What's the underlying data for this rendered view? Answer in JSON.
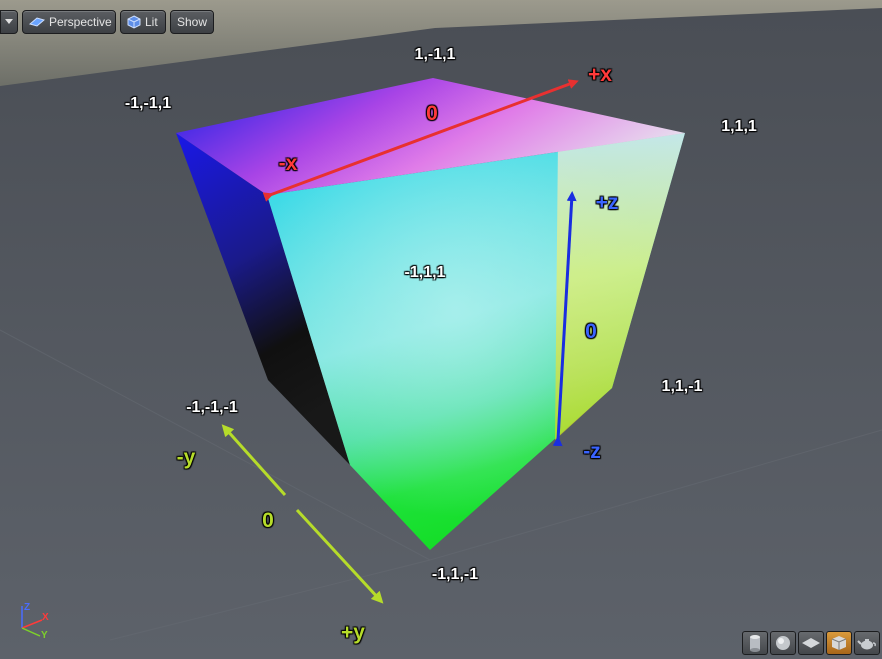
{
  "toolbar": {
    "menu_icon": "chevron-down-icon",
    "perspective_label": "Perspective",
    "lit_label": "Lit",
    "show_label": "Show"
  },
  "scene": {
    "vertex_labels": {
      "top_back": "1,-1,1",
      "top_left": "-1,-1,1",
      "top_right": "1,1,1",
      "front_top": "-1,1,1",
      "left_bottom": "-1,-1,-1",
      "right_bottom": "1,1,-1",
      "front_bottom": "-1,1,-1"
    },
    "axes": {
      "x": {
        "neg": "-x",
        "pos": "+x",
        "zero": "0",
        "color": "#e83030"
      },
      "y": {
        "neg": "-y",
        "pos": "+y",
        "zero": "0",
        "color": "#b6dc2a"
      },
      "z": {
        "neg": "-z",
        "pos": "+z",
        "zero": "0",
        "color": "#1a2ee0"
      }
    }
  },
  "gizmo": {
    "x": "X",
    "y": "Y",
    "z": "Z"
  },
  "view_buttons": [
    {
      "icon": "cylinder-icon"
    },
    {
      "icon": "sphere-icon"
    },
    {
      "icon": "plane-icon"
    },
    {
      "icon": "cube-icon",
      "active": true
    },
    {
      "icon": "teapot-icon"
    }
  ]
}
